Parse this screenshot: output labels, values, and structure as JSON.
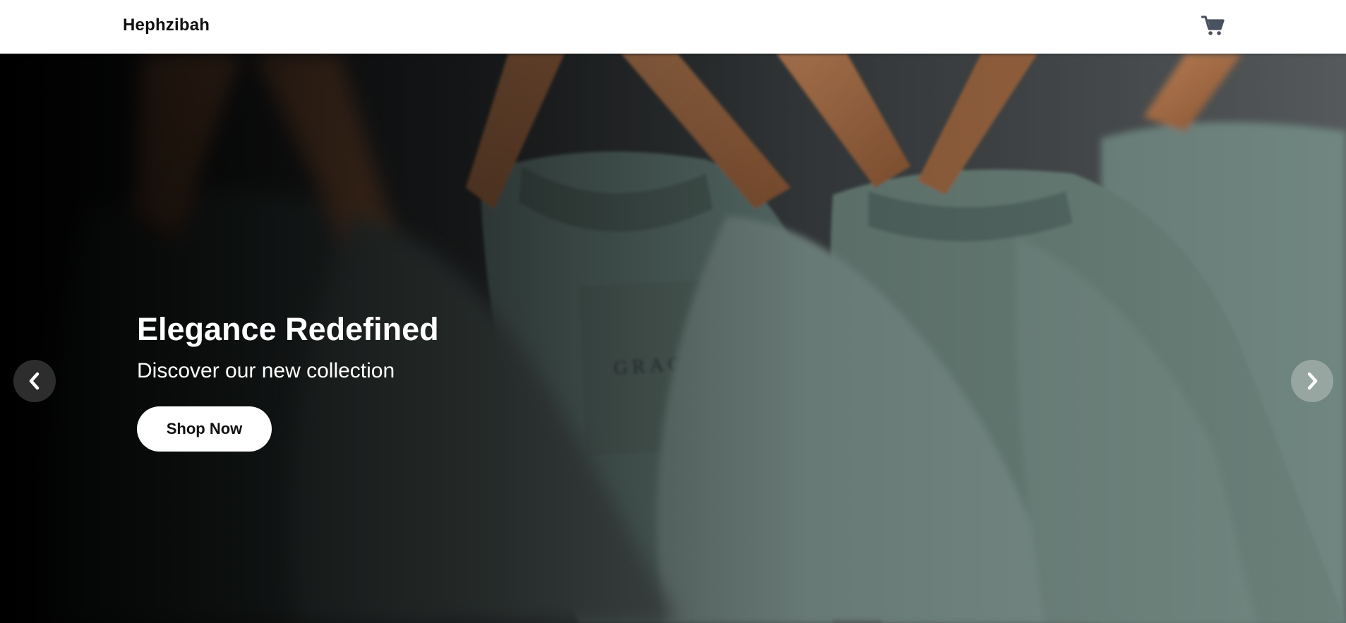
{
  "header": {
    "brand": "Hephzibah",
    "cart_icon": "shopping-cart-icon"
  },
  "hero": {
    "title": "Elegance Redefined",
    "subtitle": "Discover our new collection",
    "cta_label": "Shop Now",
    "prev_icon": "chevron-left-icon",
    "next_icon": "chevron-right-icon"
  },
  "colors": {
    "navbar_bg": "#ffffff",
    "brand_text": "#111111",
    "cart_icon": "#4a5160",
    "hero_text": "#ffffff",
    "cta_bg": "#ffffff",
    "shirt_green": "#5f7670",
    "hanger_wood": "#a8704a"
  }
}
